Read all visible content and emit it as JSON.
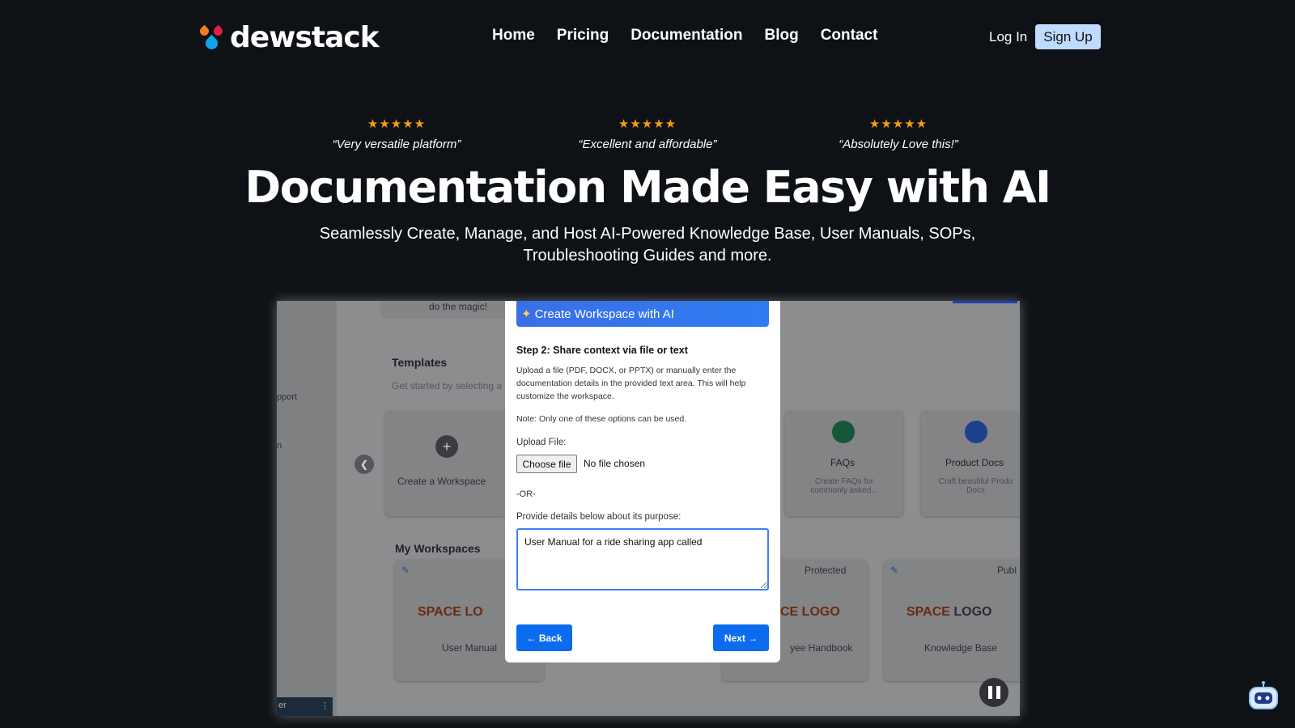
{
  "brand": {
    "name": "dewstack"
  },
  "nav": {
    "items": [
      "Home",
      "Pricing",
      "Documentation",
      "Blog",
      "Contact"
    ],
    "login": "Log In",
    "signup": "Sign Up"
  },
  "reviews": [
    {
      "stars": "★★★★★",
      "quote": "“Very versatile platform”",
      "rating": 5
    },
    {
      "stars": "★★★★★",
      "quote": "“Excellent and affordable”",
      "rating": 5
    },
    {
      "stars": "★★★★★",
      "quote": "“Absolutely Love this!”",
      "rating": 5
    }
  ],
  "hero": {
    "title": "Documentation Made Easy with AI",
    "subtitle": "Seamlessly Create, Manage, and Host AI-Powered Knowledge Base, User Manuals, SOPs, Troubleshooting Guides and more."
  },
  "video": {
    "bg": {
      "magic": "do the magic!",
      "templates_title": "Templates",
      "templates_sub": "Get started by selecting a",
      "side_1": "pport",
      "side_2": "n",
      "create_workspace": "Create a Workspace",
      "faqs_title": "FAQs",
      "faqs_sub": "Create FAQs for commonly asked...",
      "product_docs_title": "Product Docs",
      "product_docs_sub": "Craft beautiful Produ Docs",
      "my_workspaces": "My Workspaces",
      "protected": "Protected",
      "public": "Publ",
      "logo_space": "SPACE",
      "logo_word": "LOGO",
      "logo_partial_1": "SPACE LO",
      "logo_partial_2": "CE LOGO",
      "ws_user_manual": "User Manual",
      "ws_handbook": "yee Handbook",
      "ws_knowledge": "Knowledge Base",
      "dark_tab": "er"
    },
    "modal": {
      "title": "Create Workspace with AI",
      "step": "Step 2: Share context via file or text",
      "desc": "Upload a file (PDF, DOCX, or PPTX) or manually enter the documentation details in the provided text area. This will help customize the workspace.",
      "note": "Note: Only one of these options can be used.",
      "upload_label": "Upload File:",
      "choose_file": "Choose file",
      "no_file": "No file chosen",
      "or": "-OR-",
      "provide_label": "Provide details below about its purpose:",
      "textarea_value": "User Manual for a ride sharing app called ",
      "back": "Back",
      "next": "Next"
    }
  },
  "colors": {
    "accent": "#0b6cf0",
    "star": "#f59e0b",
    "signup_bg": "#bfdbfe",
    "background": "#0e1116"
  }
}
